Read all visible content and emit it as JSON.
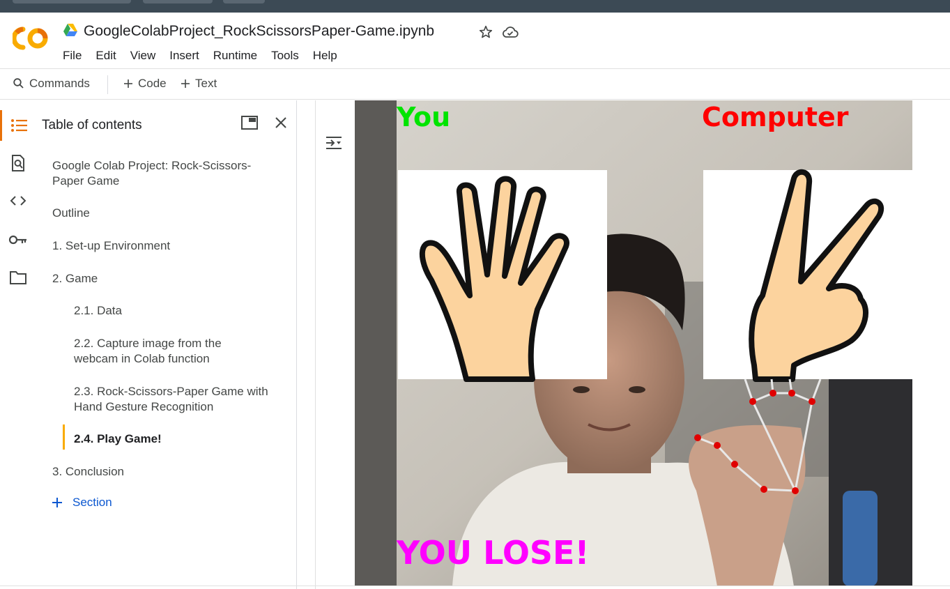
{
  "notebook": {
    "title": "GoogleColabProject_RockScissorsPaper-Game.ipynb"
  },
  "menu": [
    "File",
    "Edit",
    "View",
    "Insert",
    "Runtime",
    "Tools",
    "Help"
  ],
  "toolbar": {
    "commands_label": "Commands",
    "code_label": "Code",
    "text_label": "Text"
  },
  "toc": {
    "title": "Table of contents",
    "entries": [
      "Google Colab Project: Rock-Scissors-Paper Game",
      "Outline",
      "1. Set-up Environment",
      "2. Game",
      "2.1. Data",
      "2.2. Capture image from the webcam in Colab function",
      "2.3. Rock-Scissors-Paper Game with Hand Gesture Recognition",
      "2.4. Play Game!",
      "3. Conclusion"
    ],
    "active_entry": "2.4. Play Game!",
    "add_section_label": "Section"
  },
  "output": {
    "player_label": "You",
    "computer_label": "Computer",
    "result_text": "YOU LOSE!",
    "player_gesture": "paper",
    "computer_gesture": "scissors",
    "colors": {
      "player_label": "#00e400",
      "computer_label": "#ff0000",
      "result": "#ff00ff",
      "landmark": "#e00000"
    }
  },
  "colors": {
    "accent_orange": "#e8710a",
    "link_blue": "#0b57d0",
    "active_bar": "#f9ab00"
  }
}
